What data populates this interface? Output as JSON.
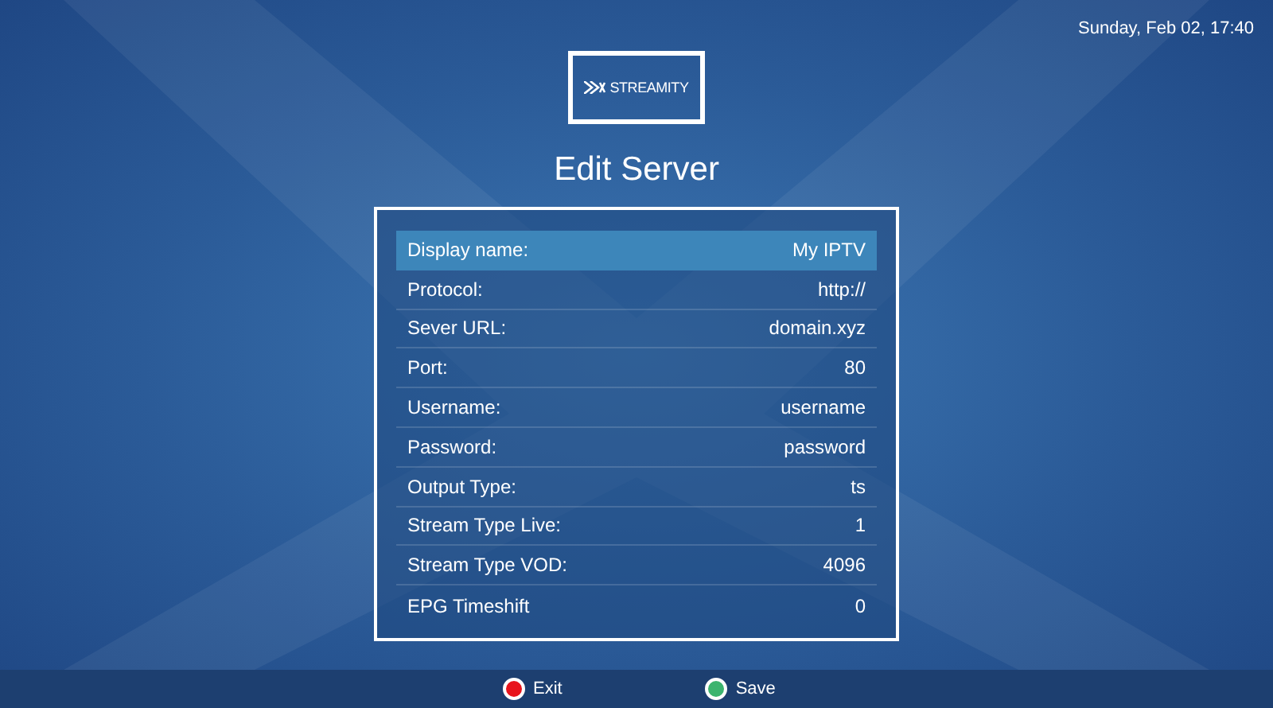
{
  "clock": "Sunday, Feb 02, 17:40",
  "logo": {
    "text": "STREAMITY"
  },
  "title": "Edit Server",
  "fields": [
    {
      "label": "Display name:",
      "value": "My IPTV",
      "selected": true
    },
    {
      "label": "Protocol:",
      "value": "http://",
      "selected": false
    },
    {
      "label": "Sever URL:",
      "value": "domain.xyz",
      "selected": false
    },
    {
      "label": "Port:",
      "value": "80",
      "selected": false
    },
    {
      "label": "Username:",
      "value": "username",
      "selected": false
    },
    {
      "label": "Password:",
      "value": "password",
      "selected": false
    },
    {
      "label": "Output Type:",
      "value": "ts",
      "selected": false
    },
    {
      "label": "Stream Type Live:",
      "value": "1",
      "selected": false
    },
    {
      "label": "Stream Type VOD:",
      "value": "4096",
      "selected": false
    },
    {
      "label": "EPG Timeshift",
      "value": "0",
      "selected": false
    }
  ],
  "footer": [
    {
      "label": "Exit",
      "color": "#e8141c"
    },
    {
      "label": "Save",
      "color": "#3cb46e"
    }
  ]
}
